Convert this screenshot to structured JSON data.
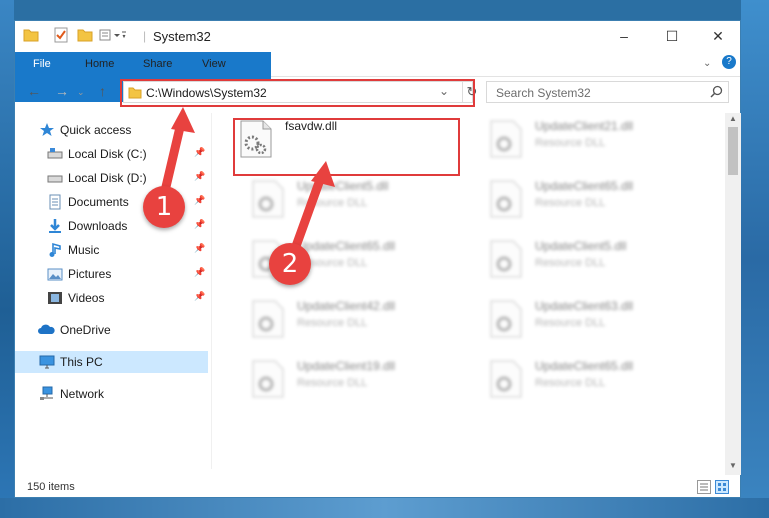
{
  "window": {
    "title": "System32",
    "controls": {
      "minimize": "–",
      "maximize": "☐",
      "close": "✕"
    }
  },
  "ribbon": {
    "tabs": [
      "File",
      "Home",
      "Share",
      "View"
    ]
  },
  "address_bar": {
    "path": "C:\\Windows\\System32"
  },
  "search": {
    "placeholder": "Search System32"
  },
  "sidebar": {
    "items": [
      {
        "label": "Quick access",
        "icon": "star-icon"
      },
      {
        "label": "Local Disk (C:)",
        "icon": "drive-icon",
        "pinned": true
      },
      {
        "label": "Local Disk (D:)",
        "icon": "drive-icon",
        "pinned": true
      },
      {
        "label": "Documents",
        "icon": "documents-icon",
        "pinned": true
      },
      {
        "label": "Downloads",
        "icon": "download-icon",
        "pinned": true
      },
      {
        "label": "Music",
        "icon": "music-icon",
        "pinned": true
      },
      {
        "label": "Pictures",
        "icon": "pictures-icon",
        "pinned": true
      },
      {
        "label": "Videos",
        "icon": "videos-icon",
        "pinned": true
      },
      {
        "label": "OneDrive",
        "icon": "cloud-icon"
      },
      {
        "label": "This PC",
        "icon": "monitor-icon",
        "selected": true
      },
      {
        "label": "Network",
        "icon": "network-icon"
      }
    ]
  },
  "files": [
    {
      "name": "fsavdw.dll",
      "type": ""
    },
    {
      "name": "UpdateClient21.dll",
      "type": "Resource DLL"
    },
    {
      "name": "UpdateClient5.dll",
      "type": "Resource DLL"
    },
    {
      "name": "UpdateClient65.dll",
      "type": "Resource DLL"
    },
    {
      "name": "UpdateClient65.dll",
      "type": "Resource DLL"
    },
    {
      "name": "UpdateClient5.dll",
      "type": "Resource DLL"
    },
    {
      "name": "UpdateClient42.dll",
      "type": "Resource DLL"
    },
    {
      "name": "UpdateClient63.dll",
      "type": "Resource DLL"
    },
    {
      "name": "UpdateClient19.dll",
      "type": "Resource DLL"
    },
    {
      "name": "UpdateClient65.dll",
      "type": "Resource DLL"
    }
  ],
  "status": {
    "item_count": "150 items"
  },
  "annotations": {
    "step1": "1",
    "step2": "2"
  },
  "colors": {
    "accent": "#1979ca",
    "annotation": "#e03b3b",
    "selected_bg": "#cce8ff"
  }
}
